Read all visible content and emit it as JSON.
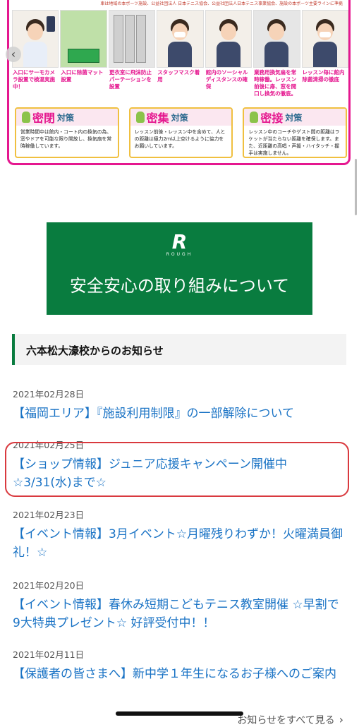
{
  "infographic": {
    "top_note": "車は地域の本ポーツ施設、公益社団法人 日本テニス協会、公益社団法人日本テニス事業協会、施設の本ポーツ主要ラインに準拠",
    "captions": [
      "入口にサーモカメラ設置で検温実施中！",
      "入口に除菌マット設置",
      "更衣室に飛沫防止パーテーションを設置",
      "スタッフマスク着用",
      "館内のソーシャルディスタンスの確保",
      "業務用換気扇を常時稼働。レッスン前後に扉、窓を開口し換気の徹底。",
      "レッスン毎に館内除菌清掃の徹底"
    ],
    "measures": [
      {
        "kanji": "密閉",
        "suffix": "対策",
        "body": "営業時間中は館内・コート内の換気の為、窓やドアを可能な限り開放し、換気扇を常時稼働しています。"
      },
      {
        "kanji": "密集",
        "suffix": "対策",
        "body": "レッスン前後・レッスン中を含めて、人との距離は極力2m以上空けるように協力をお願いしています。"
      },
      {
        "kanji": "密接",
        "suffix": "対策",
        "body": "レッスン中のコーチやゲスト間の距離はラケットが当たらない距離を確保します。また、近距離の高唱・声援・ハイタッチ・握手は実施しません。"
      }
    ],
    "prev_glyph": "‹"
  },
  "banner": {
    "logo_mark": "R",
    "logo_word": "ROUGH",
    "title": "安全安心の取り組みについて"
  },
  "news": {
    "header": "六本松大濠校からのお知らせ",
    "items": [
      {
        "date": "2021年02月28日",
        "title": "【福岡エリア】『施設利用制限』の一部解除について"
      },
      {
        "date": "2021年02月25日",
        "title": "【ショップ情報】ジュニア応援キャンペーン開催中☆3/31(水)まで☆"
      },
      {
        "date": "2021年02月23日",
        "title": "【イベント情報】3月イベント☆月曜残りわずか！火曜満員御礼！☆"
      },
      {
        "date": "2021年02月20日",
        "title": "【イベント情報】春休み短期こどもテニス教室開催 ☆早割で9大特典プレゼント☆ 好評受付中！！"
      },
      {
        "date": "2021年02月11日",
        "title": "【保護者の皆さまへ】新中学１年生になるお子様へのご案内"
      }
    ],
    "more_label": "お知らせをすべて見る",
    "more_glyph": "›"
  }
}
